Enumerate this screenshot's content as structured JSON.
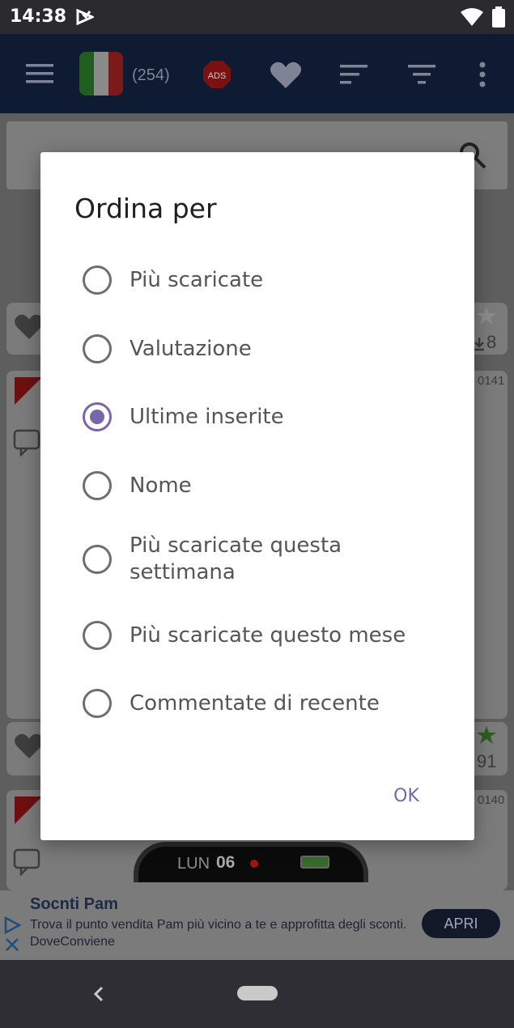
{
  "status_bar": {
    "time": "14:38"
  },
  "app_bar": {
    "count": "(254)",
    "ads_label": "ADS"
  },
  "background_cards": {
    "card1_count": "8",
    "card2_id": "0141",
    "card3_count": "91",
    "card4_id": "0140"
  },
  "watch": {
    "day": "LUN",
    "date": "06"
  },
  "ad": {
    "title": "Socnti Pam",
    "description": "Trova il punto vendita Pam più vicino a te e approfitta degli sconti. DoveConviene",
    "cta": "APRI"
  },
  "dialog": {
    "title": "Ordina per",
    "options": [
      {
        "label": "Più scaricate",
        "selected": false
      },
      {
        "label": "Valutazione",
        "selected": false
      },
      {
        "label": "Ultime inserite",
        "selected": true
      },
      {
        "label": "Nome",
        "selected": false
      },
      {
        "label": "Più scaricate questa settimana",
        "selected": false
      },
      {
        "label": "Più scaricate questo mese",
        "selected": false
      },
      {
        "label": "Commentate di recente",
        "selected": false
      }
    ],
    "ok_label": "OK"
  },
  "colors": {
    "accent": "#7767a8",
    "appbar": "#0f1b33",
    "dialog_bg": "#ffffff"
  },
  "icons": [
    "menu-icon",
    "italy-flag-icon",
    "ads-block-icon",
    "heart-icon",
    "sort-icon",
    "filter-icon",
    "more-vert-icon",
    "search-icon",
    "star-icon",
    "download-icon",
    "new-badge-icon",
    "comment-icon",
    "adchoices-icon",
    "close-icon",
    "back-icon",
    "home-icon"
  ]
}
